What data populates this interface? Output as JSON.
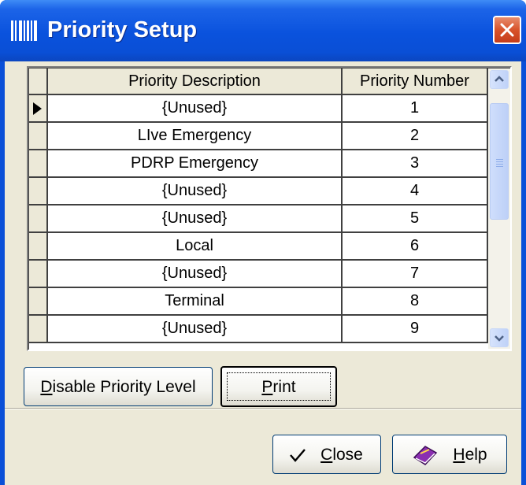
{
  "window": {
    "title": "Priority Setup",
    "title_icon": "barcode-icon",
    "close_icon": "close-icon"
  },
  "grid": {
    "columns": [
      "Priority Description",
      "Priority Number"
    ],
    "current_row": 0,
    "rows": [
      {
        "description": "{Unused}",
        "number": "1"
      },
      {
        "description": "LIve Emergency",
        "number": "2"
      },
      {
        "description": "PDRP Emergency",
        "number": "3"
      },
      {
        "description": "{Unused}",
        "number": "4"
      },
      {
        "description": "{Unused}",
        "number": "5"
      },
      {
        "description": "Local",
        "number": "6"
      },
      {
        "description": "{Unused}",
        "number": "7"
      },
      {
        "description": "Terminal",
        "number": "8"
      },
      {
        "description": "{Unused}",
        "number": "9"
      }
    ]
  },
  "buttons": {
    "disable_priority_level": {
      "mnemonic": "D",
      "rest": "isable Priority Level"
    },
    "print": {
      "mnemonic": "P",
      "rest": "rint"
    },
    "close": {
      "mnemonic": "C",
      "rest": "lose",
      "icon": "checkmark-icon"
    },
    "help": {
      "mnemonic": "H",
      "rest": "elp",
      "icon": "help-book-icon"
    }
  },
  "colors": {
    "titlebar": "#0a4fd6",
    "client_bg": "#ece9d8",
    "close_button": "#d8532b"
  }
}
